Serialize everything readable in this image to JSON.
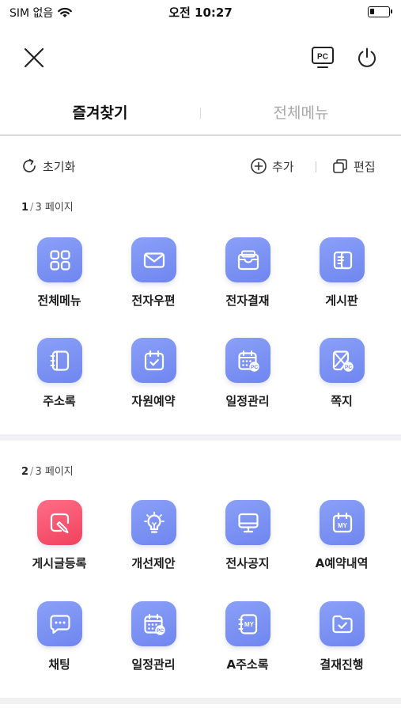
{
  "status_bar": {
    "carrier": "SIM 없음",
    "time": "오전 10:27",
    "battery_level": 0.25
  },
  "topbar": {
    "pc_label": "PC"
  },
  "tabs": [
    {
      "label": "즐겨찾기",
      "active": true
    },
    {
      "label": "전체메뉴",
      "active": false
    }
  ],
  "toolbar": {
    "reset_label": "초기화",
    "add_label": "추가",
    "edit_label": "편집"
  },
  "pages": [
    {
      "current": "1",
      "total": "3",
      "suffix": "페이지",
      "items": [
        {
          "label": "전체메뉴",
          "icon": "grid-icon",
          "color": "#7b90f4"
        },
        {
          "label": "전자우편",
          "icon": "mail-icon",
          "color": "#7b90f4"
        },
        {
          "label": "전자결재",
          "icon": "approval-tray-icon",
          "color": "#7b90f4"
        },
        {
          "label": "게시판",
          "icon": "board-icon",
          "color": "#7b90f4"
        },
        {
          "label": "주소록",
          "icon": "address-book-icon",
          "color": "#7b90f4"
        },
        {
          "label": "자원예약",
          "icon": "calendar-check-icon",
          "color": "#7b90f4"
        },
        {
          "label": "일정관리",
          "icon": "calendar-pc-icon",
          "color": "#7b90f4"
        },
        {
          "label": "쪽지",
          "icon": "note-pc-icon",
          "color": "#7b90f4"
        }
      ]
    },
    {
      "current": "2",
      "total": "3",
      "suffix": "페이지",
      "items": [
        {
          "label": "게시글등록",
          "icon": "post-write-icon",
          "color": "#f04f6a"
        },
        {
          "label": "개선제안",
          "icon": "lightbulb-icon",
          "color": "#7b90f4"
        },
        {
          "label": "전사공지",
          "icon": "monitor-icon",
          "color": "#7b90f4"
        },
        {
          "label": "A예약내역",
          "icon": "calendar-my-icon",
          "color": "#7b90f4"
        },
        {
          "label": "채팅",
          "icon": "chat-icon",
          "color": "#7b90f4"
        },
        {
          "label": "일정관리",
          "icon": "calendar-pc-icon",
          "color": "#7b90f4"
        },
        {
          "label": "A주소록",
          "icon": "address-book-my-icon",
          "color": "#7b90f4"
        },
        {
          "label": "결재진행",
          "icon": "folder-check-icon",
          "color": "#7b90f4"
        }
      ]
    }
  ]
}
